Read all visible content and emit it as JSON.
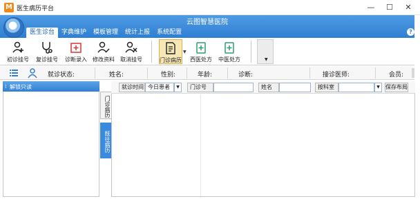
{
  "window": {
    "app_icon": "M",
    "title": "医生病历平台",
    "controls": [
      "—",
      "☐",
      "✕"
    ]
  },
  "header": {
    "hospital_name": "云图智慧医院",
    "help": "?"
  },
  "menu": [
    "医生诊台",
    "字典维护",
    "模板管理",
    "统计上报",
    "系统配置"
  ],
  "ribbon": {
    "buttons": [
      {
        "label": "初诊挂号",
        "icon": "add-user-icon"
      },
      {
        "label": "复诊挂号",
        "icon": "stethoscope-icon"
      },
      {
        "label": "诊断录入",
        "icon": "medical-kit-icon"
      },
      {
        "label": "修改资料",
        "icon": "edit-user-icon"
      },
      {
        "label": "取消挂号",
        "icon": "remove-user-icon"
      },
      {
        "label": "门诊病历",
        "icon": "record-icon"
      },
      {
        "label": "西医处方",
        "icon": "western-rx-icon"
      },
      {
        "label": "中医处方",
        "icon": "chinese-rx-icon"
      }
    ],
    "selected": "门诊病历"
  },
  "infobar": {
    "visit_status_label": "就诊状态:",
    "name_label": "姓名:",
    "gender_label": "性别:",
    "age_label": "年龄:",
    "diagnosis_label": "诊断:",
    "doctor_label": "接诊医师:",
    "member_label": "会员:"
  },
  "left_panel": {
    "title": "解锁只读",
    "dots": "⁞"
  },
  "vertical_tabs": [
    "门诊病历",
    "既往病历"
  ],
  "filter": {
    "visit_time_label": "就诊时间",
    "visit_time_value": "今日患者",
    "clinic_no_label": "门诊号",
    "name_label": "姓名",
    "department_label": "按科室",
    "save_layout": "保存布局"
  },
  "colors": {
    "primary": "#2f7fd2",
    "selected_tab_fill": "#f7e7b5",
    "panel_header": "#3a8be0"
  }
}
